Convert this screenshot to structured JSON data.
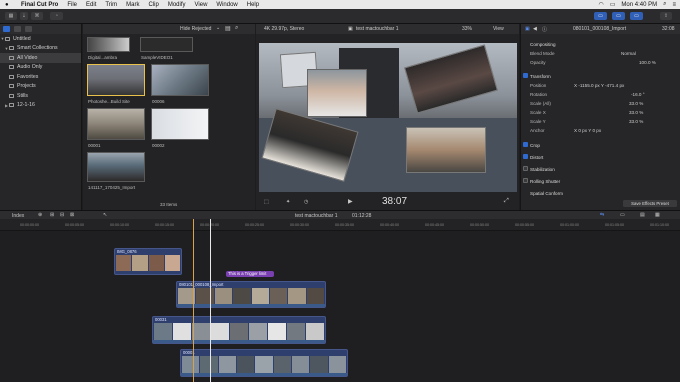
{
  "menubar": {
    "app_name": "Final Cut Pro",
    "items": [
      "File",
      "Edit",
      "Trim",
      "Mark",
      "Clip",
      "Modify",
      "View",
      "Window",
      "Help"
    ],
    "clock": "Mon 4:40 PM"
  },
  "sidebar": {
    "items": [
      {
        "label": "Untitled"
      },
      {
        "label": "Smart Collections"
      },
      {
        "label": "All Video"
      },
      {
        "label": "Audio Only"
      },
      {
        "label": "Favorites"
      },
      {
        "label": "Projects"
      },
      {
        "label": "Stills"
      },
      {
        "label": "12-1-16"
      }
    ]
  },
  "browser": {
    "filter": "Hide Rejected",
    "items_count": "33 Items",
    "clips": [
      {
        "label": "Digital...ambra"
      },
      {
        "label": "SampleVIDEO1"
      },
      {
        "label": "Photoshe...Build Site"
      },
      {
        "label": "00006"
      },
      {
        "label": "00001"
      },
      {
        "label": "00002"
      },
      {
        "label": "141117_170425_Import"
      }
    ]
  },
  "viewer": {
    "format": "4K 29.97p, Stereo",
    "title": "test mactouchbar 1",
    "zoom": "33%",
    "view": "View",
    "timecode": "38:07"
  },
  "inspector": {
    "clip_name": "080101_000108_Import",
    "duration": "32:08",
    "rows": [
      {
        "label": "Compositing",
        "value": ""
      },
      {
        "label": "Blend Mode",
        "value": "Normal"
      },
      {
        "label": "Opacity",
        "value": "100.0 %"
      },
      {
        "label": "Transform",
        "value": ""
      },
      {
        "label": "Position",
        "value": "X  -1155.0 px    Y  -471.4 px"
      },
      {
        "label": "Rotation",
        "value": "-16.0 °"
      },
      {
        "label": "Scale (All)",
        "value": "33.0 %"
      },
      {
        "label": "Scale X",
        "value": "33.0 %"
      },
      {
        "label": "Scale Y",
        "value": "33.0 %"
      },
      {
        "label": "Anchor",
        "value": "X  0 px    Y  0 px"
      },
      {
        "label": "Crop",
        "value": ""
      },
      {
        "label": "Distort",
        "value": ""
      },
      {
        "label": "Stabilization",
        "value": ""
      },
      {
        "label": "Rolling Shutter",
        "value": ""
      },
      {
        "label": "Spatial Conform",
        "value": ""
      }
    ],
    "save_preset": "Save Effects Preset"
  },
  "timeline": {
    "index_label": "Index",
    "project_name": "test mactouchbar 1",
    "duration": "01:12:28",
    "ruler_ticks": [
      "00:00:00:00",
      "00:00:05:00",
      "00:00:10:00",
      "00:00:15:00",
      "00:00:20:00",
      "00:00:25:00",
      "00:00:30:00",
      "00:00:35:00",
      "00:00:40:00",
      "00:00:45:00",
      "00:00:50:00",
      "00:00:55:00",
      "00:01:00:00",
      "00:01:05:00",
      "00:01:10:00"
    ],
    "title_clip": "This is a Trigger limit",
    "clips": [
      {
        "name": "IMG_0876"
      },
      {
        "name": "080101_000108_Import"
      },
      {
        "name": "00031"
      },
      {
        "name": "00001"
      }
    ]
  }
}
